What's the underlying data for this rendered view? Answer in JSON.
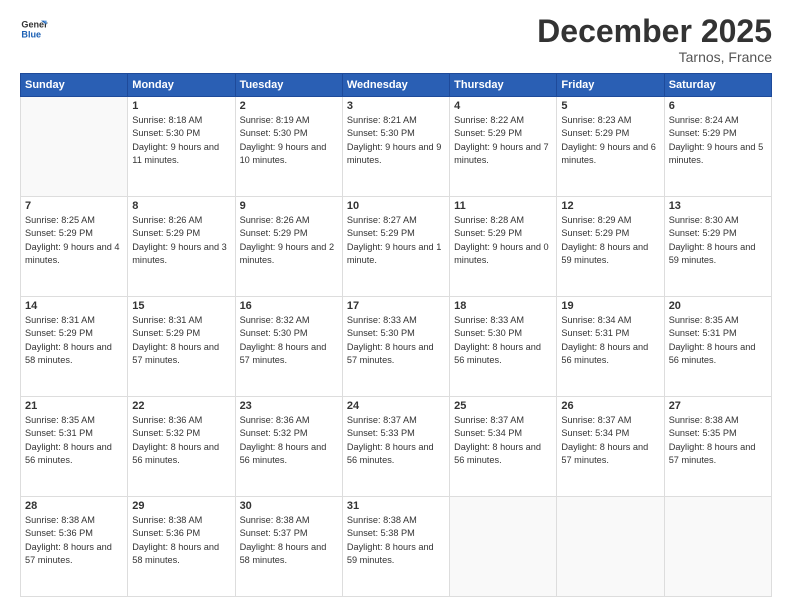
{
  "header": {
    "logo_line1": "General",
    "logo_line2": "Blue",
    "month": "December 2025",
    "location": "Tarnos, France"
  },
  "weekdays": [
    "Sunday",
    "Monday",
    "Tuesday",
    "Wednesday",
    "Thursday",
    "Friday",
    "Saturday"
  ],
  "weeks": [
    [
      {
        "day": "",
        "empty": true
      },
      {
        "day": "1",
        "sunrise": "8:18 AM",
        "sunset": "5:30 PM",
        "daylight": "9 hours and 11 minutes."
      },
      {
        "day": "2",
        "sunrise": "8:19 AM",
        "sunset": "5:30 PM",
        "daylight": "9 hours and 10 minutes."
      },
      {
        "day": "3",
        "sunrise": "8:21 AM",
        "sunset": "5:30 PM",
        "daylight": "9 hours and 9 minutes."
      },
      {
        "day": "4",
        "sunrise": "8:22 AM",
        "sunset": "5:29 PM",
        "daylight": "9 hours and 7 minutes."
      },
      {
        "day": "5",
        "sunrise": "8:23 AM",
        "sunset": "5:29 PM",
        "daylight": "9 hours and 6 minutes."
      },
      {
        "day": "6",
        "sunrise": "8:24 AM",
        "sunset": "5:29 PM",
        "daylight": "9 hours and 5 minutes."
      }
    ],
    [
      {
        "day": "7",
        "sunrise": "8:25 AM",
        "sunset": "5:29 PM",
        "daylight": "9 hours and 4 minutes."
      },
      {
        "day": "8",
        "sunrise": "8:26 AM",
        "sunset": "5:29 PM",
        "daylight": "9 hours and 3 minutes."
      },
      {
        "day": "9",
        "sunrise": "8:26 AM",
        "sunset": "5:29 PM",
        "daylight": "9 hours and 2 minutes."
      },
      {
        "day": "10",
        "sunrise": "8:27 AM",
        "sunset": "5:29 PM",
        "daylight": "9 hours and 1 minute."
      },
      {
        "day": "11",
        "sunrise": "8:28 AM",
        "sunset": "5:29 PM",
        "daylight": "9 hours and 0 minutes."
      },
      {
        "day": "12",
        "sunrise": "8:29 AM",
        "sunset": "5:29 PM",
        "daylight": "8 hours and 59 minutes."
      },
      {
        "day": "13",
        "sunrise": "8:30 AM",
        "sunset": "5:29 PM",
        "daylight": "8 hours and 59 minutes."
      }
    ],
    [
      {
        "day": "14",
        "sunrise": "8:31 AM",
        "sunset": "5:29 PM",
        "daylight": "8 hours and 58 minutes."
      },
      {
        "day": "15",
        "sunrise": "8:31 AM",
        "sunset": "5:29 PM",
        "daylight": "8 hours and 57 minutes."
      },
      {
        "day": "16",
        "sunrise": "8:32 AM",
        "sunset": "5:30 PM",
        "daylight": "8 hours and 57 minutes."
      },
      {
        "day": "17",
        "sunrise": "8:33 AM",
        "sunset": "5:30 PM",
        "daylight": "8 hours and 57 minutes."
      },
      {
        "day": "18",
        "sunrise": "8:33 AM",
        "sunset": "5:30 PM",
        "daylight": "8 hours and 56 minutes."
      },
      {
        "day": "19",
        "sunrise": "8:34 AM",
        "sunset": "5:31 PM",
        "daylight": "8 hours and 56 minutes."
      },
      {
        "day": "20",
        "sunrise": "8:35 AM",
        "sunset": "5:31 PM",
        "daylight": "8 hours and 56 minutes."
      }
    ],
    [
      {
        "day": "21",
        "sunrise": "8:35 AM",
        "sunset": "5:31 PM",
        "daylight": "8 hours and 56 minutes."
      },
      {
        "day": "22",
        "sunrise": "8:36 AM",
        "sunset": "5:32 PM",
        "daylight": "8 hours and 56 minutes."
      },
      {
        "day": "23",
        "sunrise": "8:36 AM",
        "sunset": "5:32 PM",
        "daylight": "8 hours and 56 minutes."
      },
      {
        "day": "24",
        "sunrise": "8:37 AM",
        "sunset": "5:33 PM",
        "daylight": "8 hours and 56 minutes."
      },
      {
        "day": "25",
        "sunrise": "8:37 AM",
        "sunset": "5:34 PM",
        "daylight": "8 hours and 56 minutes."
      },
      {
        "day": "26",
        "sunrise": "8:37 AM",
        "sunset": "5:34 PM",
        "daylight": "8 hours and 57 minutes."
      },
      {
        "day": "27",
        "sunrise": "8:38 AM",
        "sunset": "5:35 PM",
        "daylight": "8 hours and 57 minutes."
      }
    ],
    [
      {
        "day": "28",
        "sunrise": "8:38 AM",
        "sunset": "5:36 PM",
        "daylight": "8 hours and 57 minutes."
      },
      {
        "day": "29",
        "sunrise": "8:38 AM",
        "sunset": "5:36 PM",
        "daylight": "8 hours and 58 minutes."
      },
      {
        "day": "30",
        "sunrise": "8:38 AM",
        "sunset": "5:37 PM",
        "daylight": "8 hours and 58 minutes."
      },
      {
        "day": "31",
        "sunrise": "8:38 AM",
        "sunset": "5:38 PM",
        "daylight": "8 hours and 59 minutes."
      },
      {
        "day": "",
        "empty": true
      },
      {
        "day": "",
        "empty": true
      },
      {
        "day": "",
        "empty": true
      }
    ]
  ]
}
